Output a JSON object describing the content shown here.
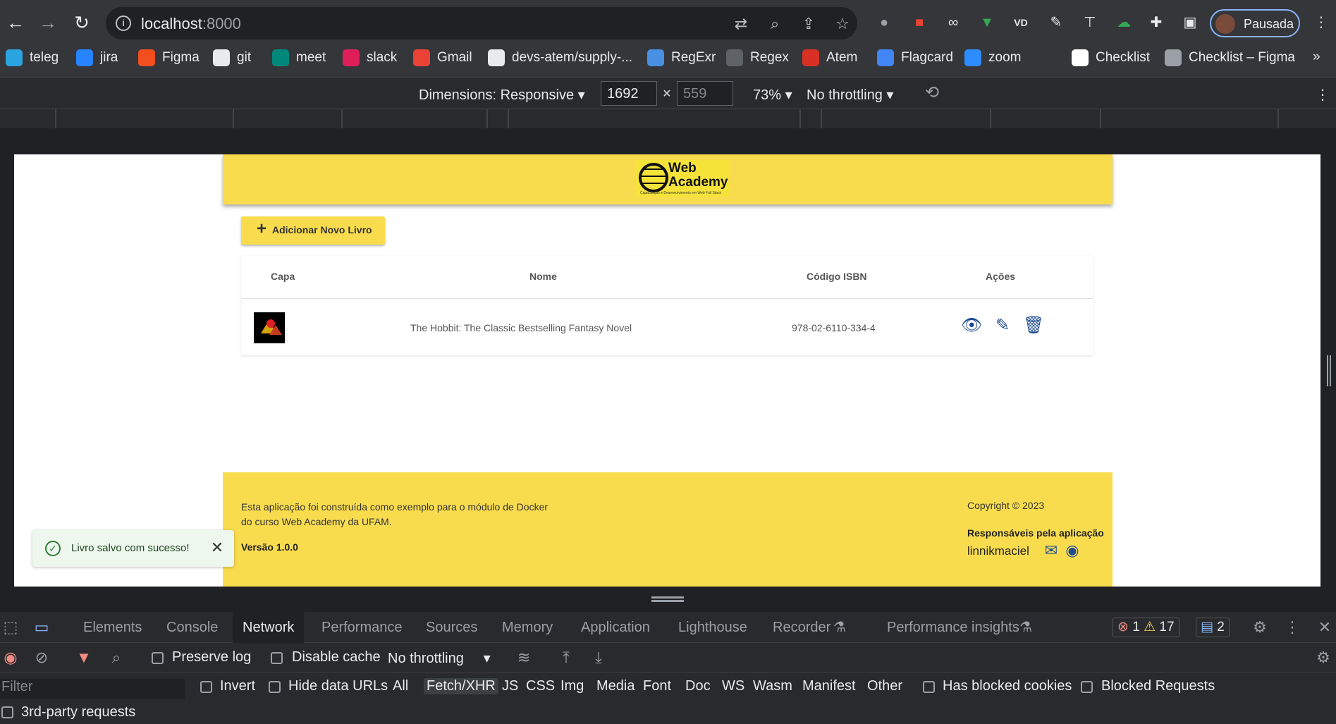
{
  "browser": {
    "url_host": "localhost",
    "url_port": ":8000",
    "profile_label": "Pausada"
  },
  "bookmarks": [
    {
      "label": "teleg",
      "color": "#2aa3e0"
    },
    {
      "label": "jira",
      "color": "#2684ff"
    },
    {
      "label": "Figma",
      "color": "#f24e1e"
    },
    {
      "label": "git",
      "color": "#e8eaed"
    },
    {
      "label": "meet",
      "color": "#00897b"
    },
    {
      "label": "slack",
      "color": "#e01e5a"
    },
    {
      "label": "Gmail",
      "color": "#ea4335"
    },
    {
      "label": "devs-atem/supply-...",
      "color": "#e8eaed"
    },
    {
      "label": "RegExr",
      "color": "#4a90e2"
    },
    {
      "label": "Regex",
      "color": "#5f6368"
    },
    {
      "label": "Atem",
      "color": "#d93025"
    },
    {
      "label": "Flagcard",
      "color": "#4285f4"
    },
    {
      "label": "zoom",
      "color": "#2d8cff"
    },
    {
      "label": "Checklist",
      "color": "#ffffff"
    },
    {
      "label": "Checklist – Figma",
      "color": "#9aa0a6"
    }
  ],
  "device_toolbar": {
    "dimensions_label": "Dimensions: Responsive",
    "width": "1692",
    "height": "559",
    "zoom": "73%",
    "throttling": "No throttling"
  },
  "app": {
    "logo_title_line1": "Web",
    "logo_title_line2": "Academy",
    "logo_subtitle": "Capacitação e Desenvolvimento em Web Full Stack",
    "add_button_label": "Adicionar Novo Livro",
    "table": {
      "columns": [
        "Capa",
        "Nome",
        "Código ISBN",
        "Ações"
      ],
      "rows": [
        {
          "name": "The Hobbit: The Classic Bestselling Fantasy Novel",
          "isbn": "978-02-6110-334-4"
        }
      ]
    },
    "footer": {
      "description": "Esta aplicação foi construída como exemplo para o módulo de Docker do curso Web Academy da UFAM.",
      "version": "Versão 1.0.0",
      "copyright": "Copyright © 2023",
      "responsible_title": "Responsáveis pela aplicação",
      "responsible_name": "linnikmaciel"
    },
    "toast_message": "Livro salvo com sucesso!"
  },
  "devtools": {
    "tabs": [
      "Elements",
      "Console",
      "Network",
      "Performance",
      "Sources",
      "Memory",
      "Application",
      "Lighthouse",
      "Recorder",
      "Performance insights"
    ],
    "active_tab": "Network",
    "errors": "1",
    "warnings": "17",
    "messages": "2",
    "preserve_log": "Preserve log",
    "disable_cache": "Disable cache",
    "throttling": "No throttling",
    "filter_placeholder": "Filter",
    "invert": "Invert",
    "hide_data_urls": "Hide data URLs",
    "filter_types": [
      "All",
      "Fetch/XHR",
      "JS",
      "CSS",
      "Img",
      "Media",
      "Font",
      "Doc",
      "WS",
      "Wasm",
      "Manifest",
      "Other"
    ],
    "selected_filter": "Fetch/XHR",
    "has_blocked_cookies": "Has blocked cookies",
    "blocked_requests": "Blocked Requests",
    "third_party": "3rd-party requests"
  }
}
